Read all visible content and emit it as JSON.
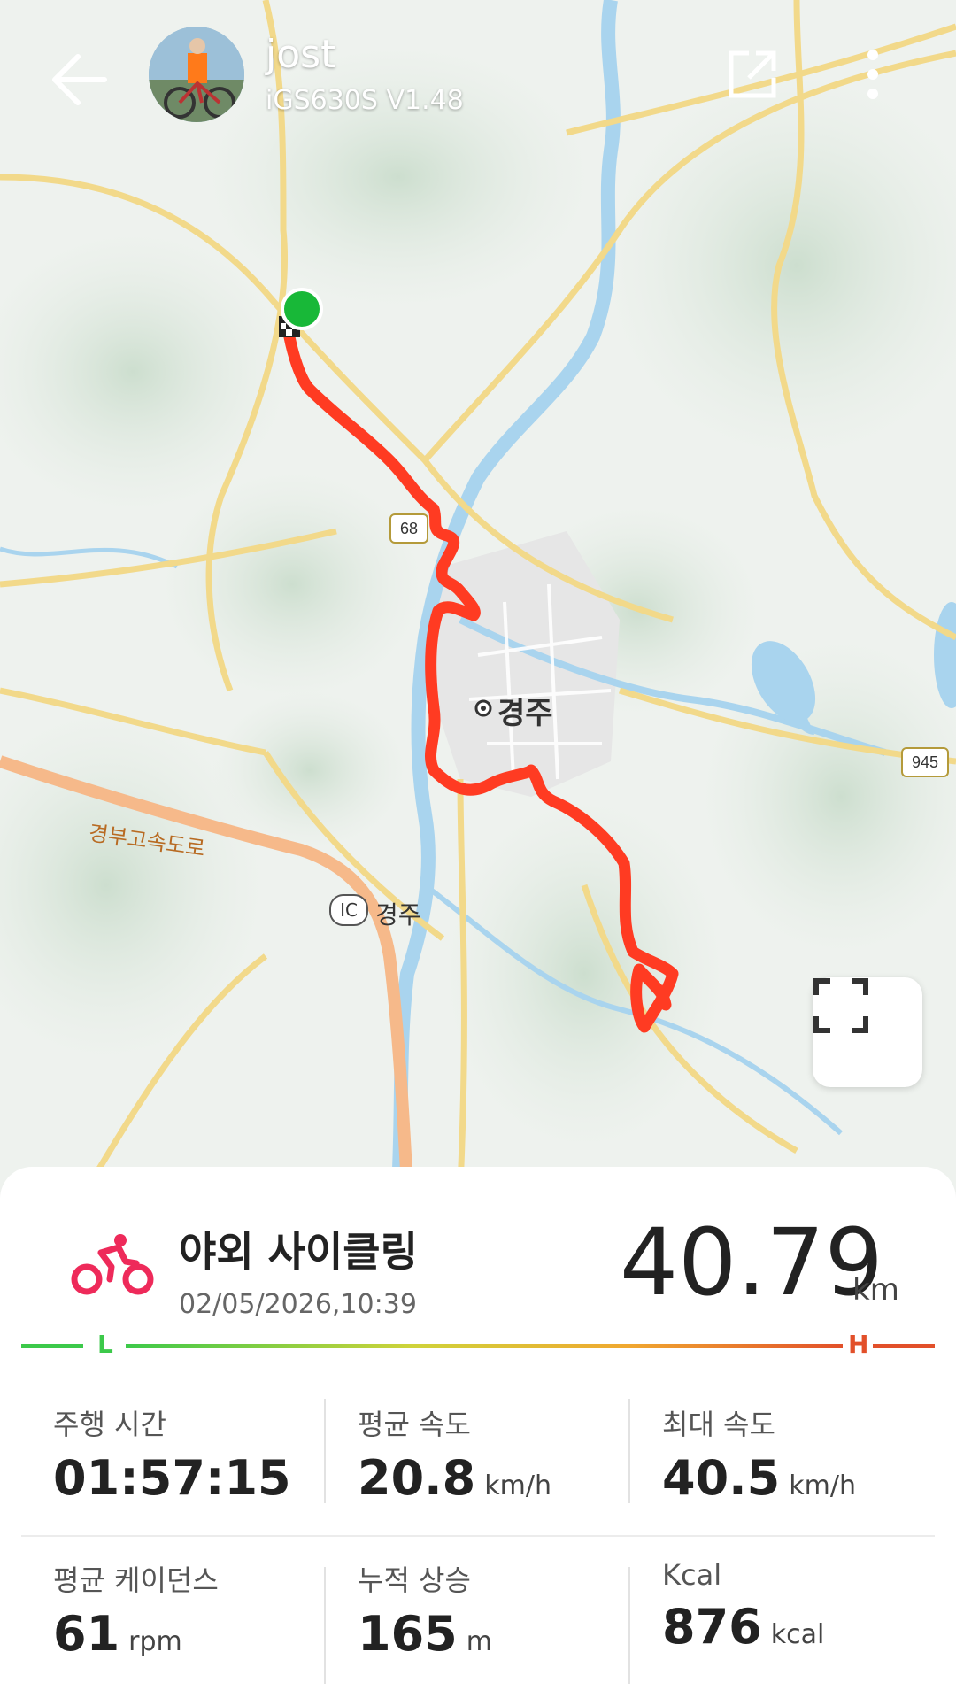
{
  "header": {
    "user_name": "jost",
    "device": "iGS630S  V1.48"
  },
  "map": {
    "labels": {
      "city": "경주",
      "ic": "경주",
      "ic_badge": "IC",
      "expressway": "경부고속도로",
      "route_68": "68",
      "route_945": "945"
    },
    "colors": {
      "route": "#ff3b22",
      "start": "#18b838",
      "water": "#a9d4ee",
      "road": "#f2d98a"
    }
  },
  "activity": {
    "title": "야외 사이클링",
    "date": "02/05/2026,10:39",
    "distance": "40.79",
    "distance_unit": "km",
    "scale_low": "L",
    "scale_high": "H",
    "icon": "cycling-icon",
    "icon_color": "#ee2a5a"
  },
  "stats": [
    {
      "label": "주행 시간",
      "value": "01:57:15",
      "unit": ""
    },
    {
      "label": "평균 속도",
      "value": "20.8",
      "unit": "km/h"
    },
    {
      "label": "최대 속도",
      "value": "40.5",
      "unit": "km/h"
    },
    {
      "label": "평균 케이던스",
      "value": "61",
      "unit": "rpm"
    },
    {
      "label": "누적 상승",
      "value": "165",
      "unit": "m"
    },
    {
      "label": "Kcal",
      "value": "876",
      "unit": "kcal"
    }
  ]
}
